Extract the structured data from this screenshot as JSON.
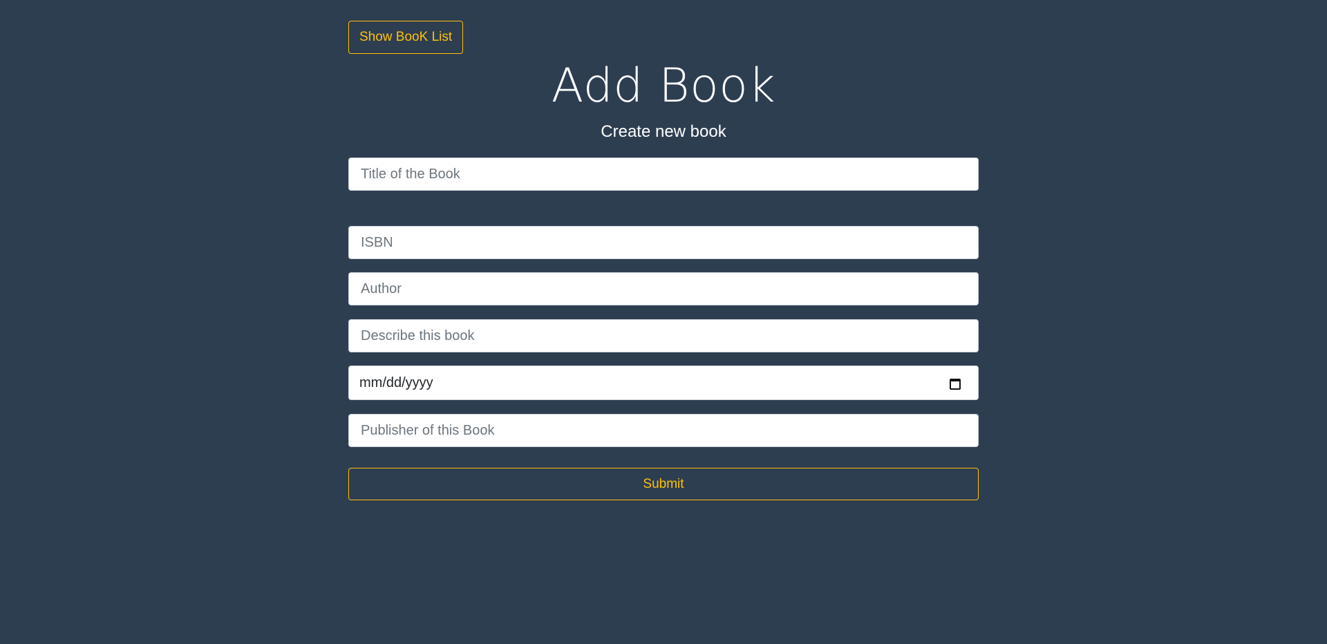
{
  "nav": {
    "back_label": "Show BooK List"
  },
  "header": {
    "title": "Add Book",
    "subtitle": "Create new book"
  },
  "form": {
    "title_placeholder": "Title of the Book",
    "isbn_placeholder": "ISBN",
    "author_placeholder": "Author",
    "description_placeholder": "Describe this book",
    "date_value": "mm/dd/yyyy",
    "publisher_placeholder": "Publisher of this Book",
    "submit_label": "Submit"
  },
  "colors": {
    "background": "#2e3e51",
    "accent": "#ffc107",
    "text": "#ffffff"
  },
  "icons": {
    "date_picker": "calendar-icon"
  }
}
